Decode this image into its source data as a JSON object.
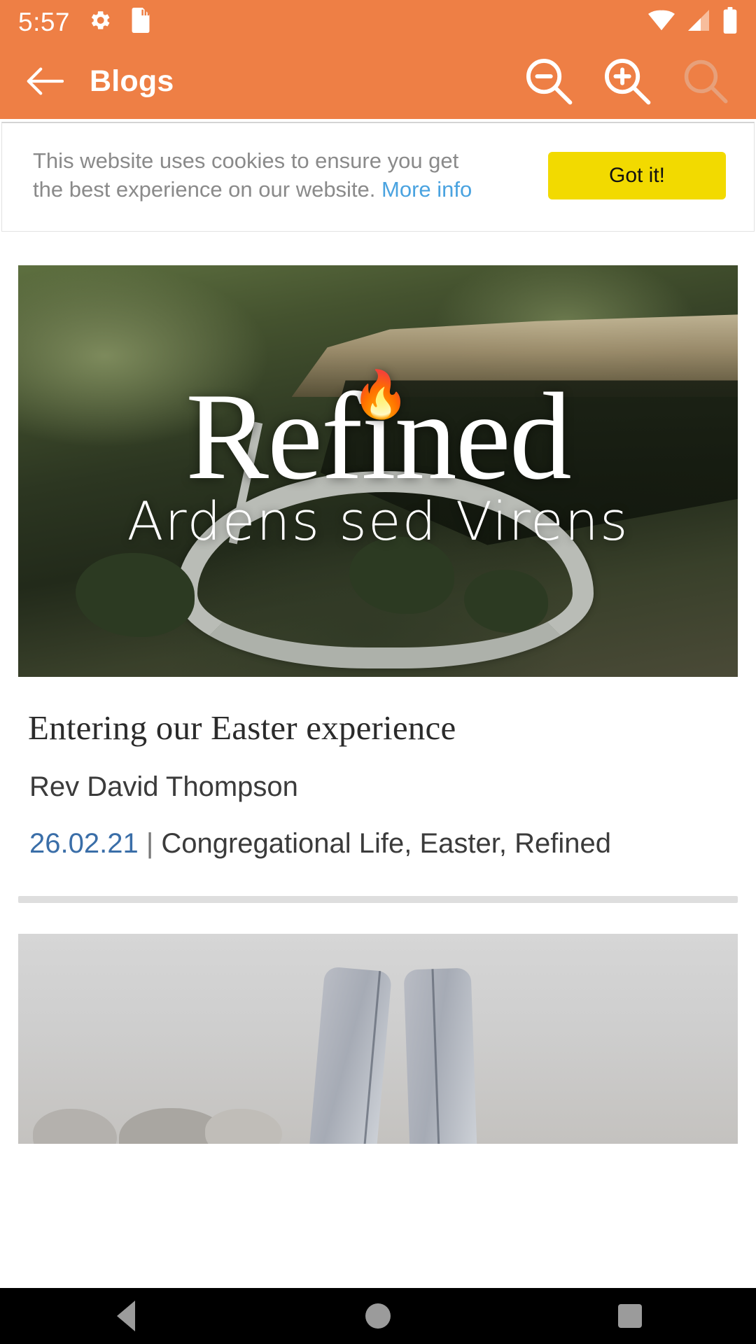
{
  "status_bar": {
    "time": "5:57",
    "icons_left": [
      "settings-gear-icon",
      "sd-card-icon"
    ],
    "icons_right": [
      "wifi-icon",
      "cellular-signal-icon",
      "battery-icon"
    ]
  },
  "app_bar": {
    "back_label": "back-arrow",
    "title": "Blogs",
    "actions": [
      {
        "name": "zoom-out",
        "label": "Zoom out"
      },
      {
        "name": "zoom-in",
        "label": "Zoom in"
      },
      {
        "name": "search",
        "label": "Search"
      }
    ]
  },
  "cookie_banner": {
    "message": "This website uses cookies to ensure you get the best experience on our website.",
    "link_label": "More info",
    "accept_label": "Got it!",
    "accept_color": "#F2DA00"
  },
  "posts": [
    {
      "hero": {
        "logo_word": "Refined",
        "logo_tagline": "Ardens sed Virens",
        "flame_icon": "flame-icon",
        "alt": "aerial view of winding mountain road through forest"
      },
      "title": "Entering our Easter experience",
      "author": "Rev David Thompson",
      "date": "26.02.21",
      "separator": "|",
      "categories": "Congregational Life, Easter, Refined",
      "date_color": "#3A6EA8"
    },
    {
      "hero": {
        "alt": "person in jeans and boots standing on stones"
      }
    }
  ],
  "nav_bar": {
    "buttons": [
      {
        "name": "nav-back",
        "label": "Back"
      },
      {
        "name": "nav-home",
        "label": "Home"
      },
      {
        "name": "nav-recents",
        "label": "Recents"
      }
    ]
  },
  "theme": {
    "accent": "#EE7F45",
    "link": "#4AA3E0",
    "text_muted": "#8A8A8A"
  }
}
